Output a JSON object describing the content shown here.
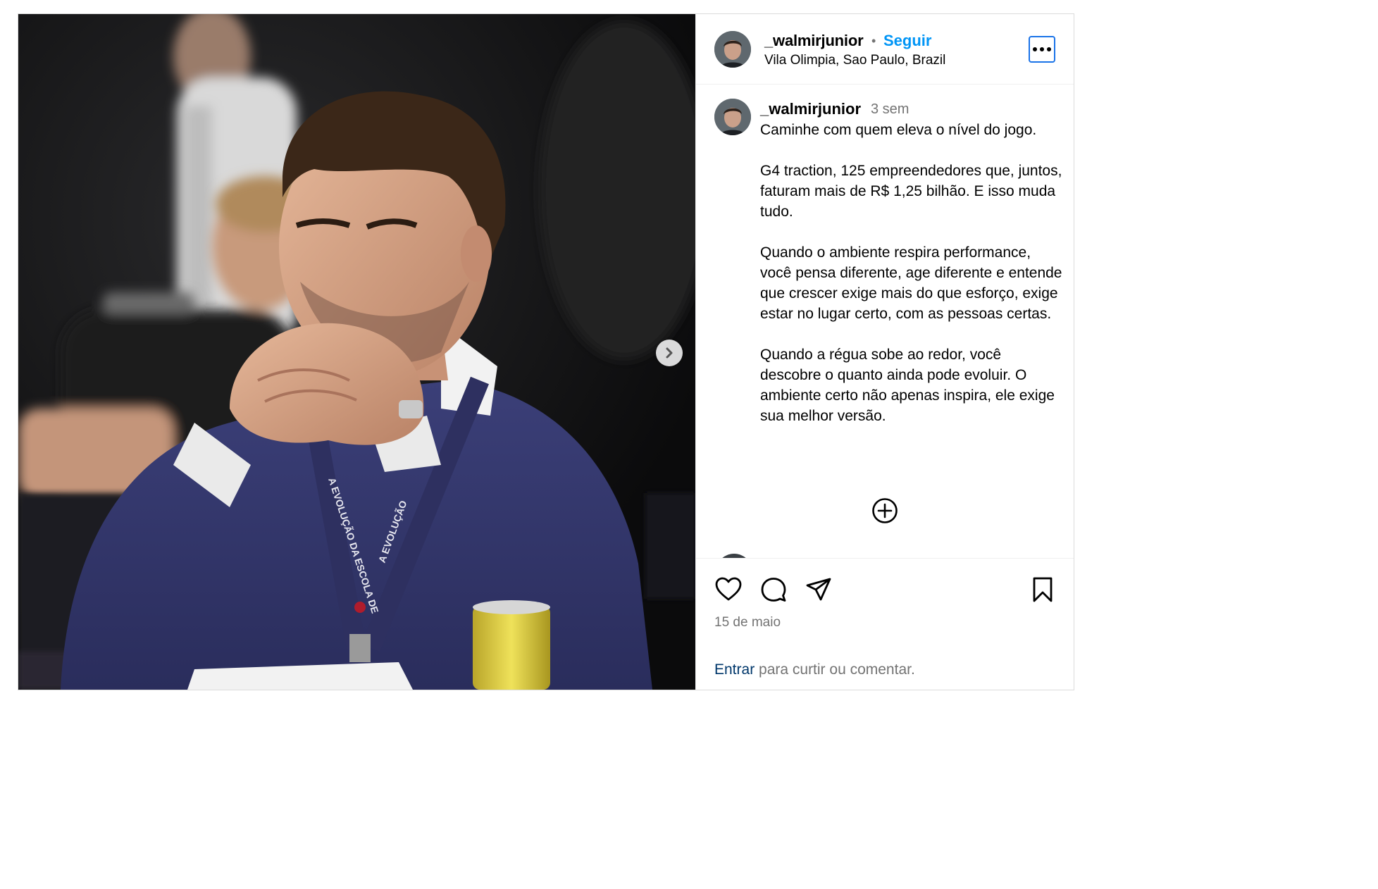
{
  "post": {
    "author": {
      "username": "_walmirjunior",
      "separator": "•",
      "follow_label": "Seguir",
      "location": "Vila Olimpia, Sao Paulo, Brazil"
    },
    "caption": {
      "username": "_walmirjunior",
      "time_ago": "3 sem",
      "paragraphs": [
        "Caminhe com quem eleva o nível do jogo.",
        "G4 traction, 125 empreendedores que, juntos, faturam mais de R$ 1,25 bilhão. E isso muda tudo.",
        "Quando o ambiente respira performance, você pensa diferente, age diferente e entende que crescer exige mais do que esforço, exige estar no lugar certo, com as pessoas certas.",
        "Quando a régua sobe ao redor, você descobre o quanto ainda pode evoluir. O ambiente certo não apenas inspira, ele exige sua melhor versão."
      ]
    },
    "photo": {
      "lanyard_text_1": "A EVOLUÇÃO DA ESCOLA DE",
      "lanyard_text_2": "A EVOLUÇÃO"
    },
    "footer": {
      "date": "15 de maio",
      "login_link": "Entrar",
      "login_rest": " para curtir ou comentar."
    },
    "icons": {
      "more": "more-options-icon",
      "next": "chevron-right-icon",
      "load_more": "plus-circle-icon",
      "like": "heart-icon",
      "comment": "comment-icon",
      "share": "send-icon",
      "save": "bookmark-icon"
    },
    "colors": {
      "accent": "#0095f6",
      "secondary_text": "#737373",
      "link": "#00376b"
    }
  }
}
